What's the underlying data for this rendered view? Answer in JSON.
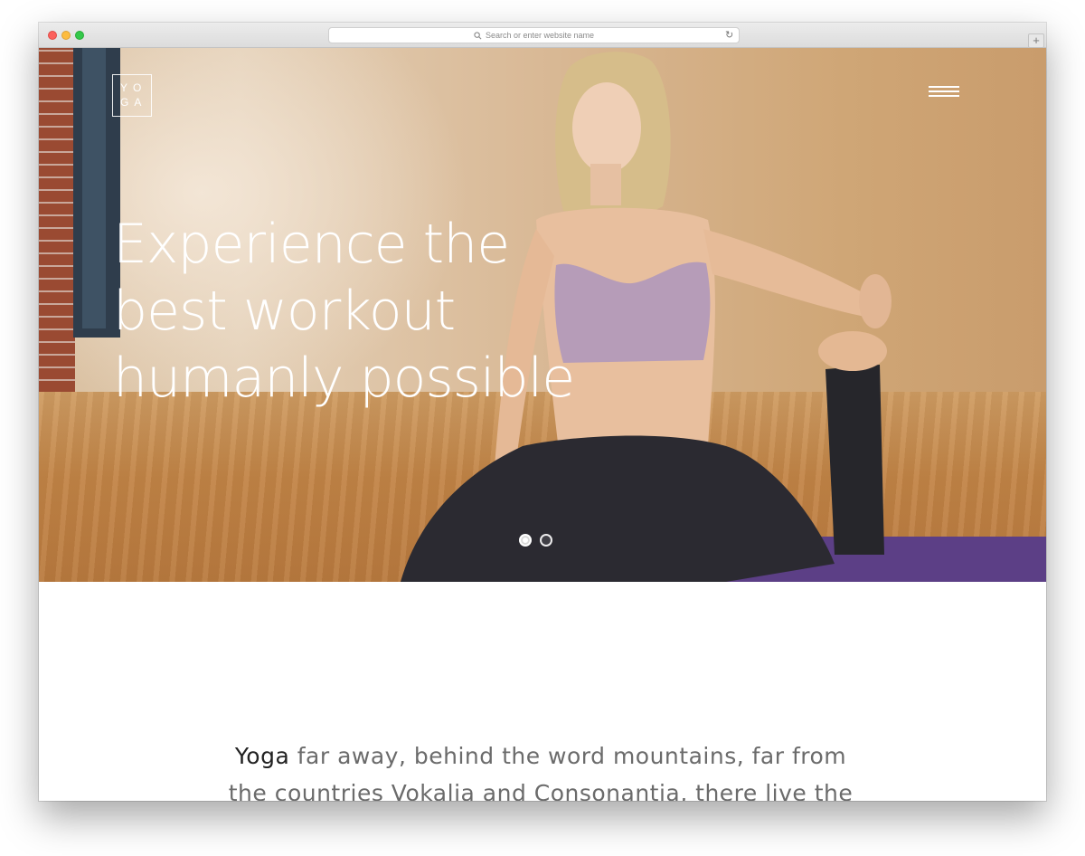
{
  "browser": {
    "url_placeholder": "Search or enter website name",
    "new_tab_label": "+",
    "reload_glyph": "↻"
  },
  "site": {
    "logo_line1": "YO",
    "logo_line2": "GA"
  },
  "hero": {
    "headline_line1": "Experience the",
    "headline_line2": "best workout",
    "headline_line3": "humanly possible",
    "slide_count": 2,
    "active_slide": 1
  },
  "intro": {
    "lead_word": "Yoga",
    "line1_rest": " far away, behind the word mountains, far from",
    "line2": "the countries Vokalia and Consonantia, there live the"
  },
  "colors": {
    "mat": "#5c3f86",
    "text_dark": "#222222",
    "text_body": "#6b6b6b"
  },
  "icons": [
    "search-icon",
    "reload-icon",
    "menu-icon"
  ]
}
